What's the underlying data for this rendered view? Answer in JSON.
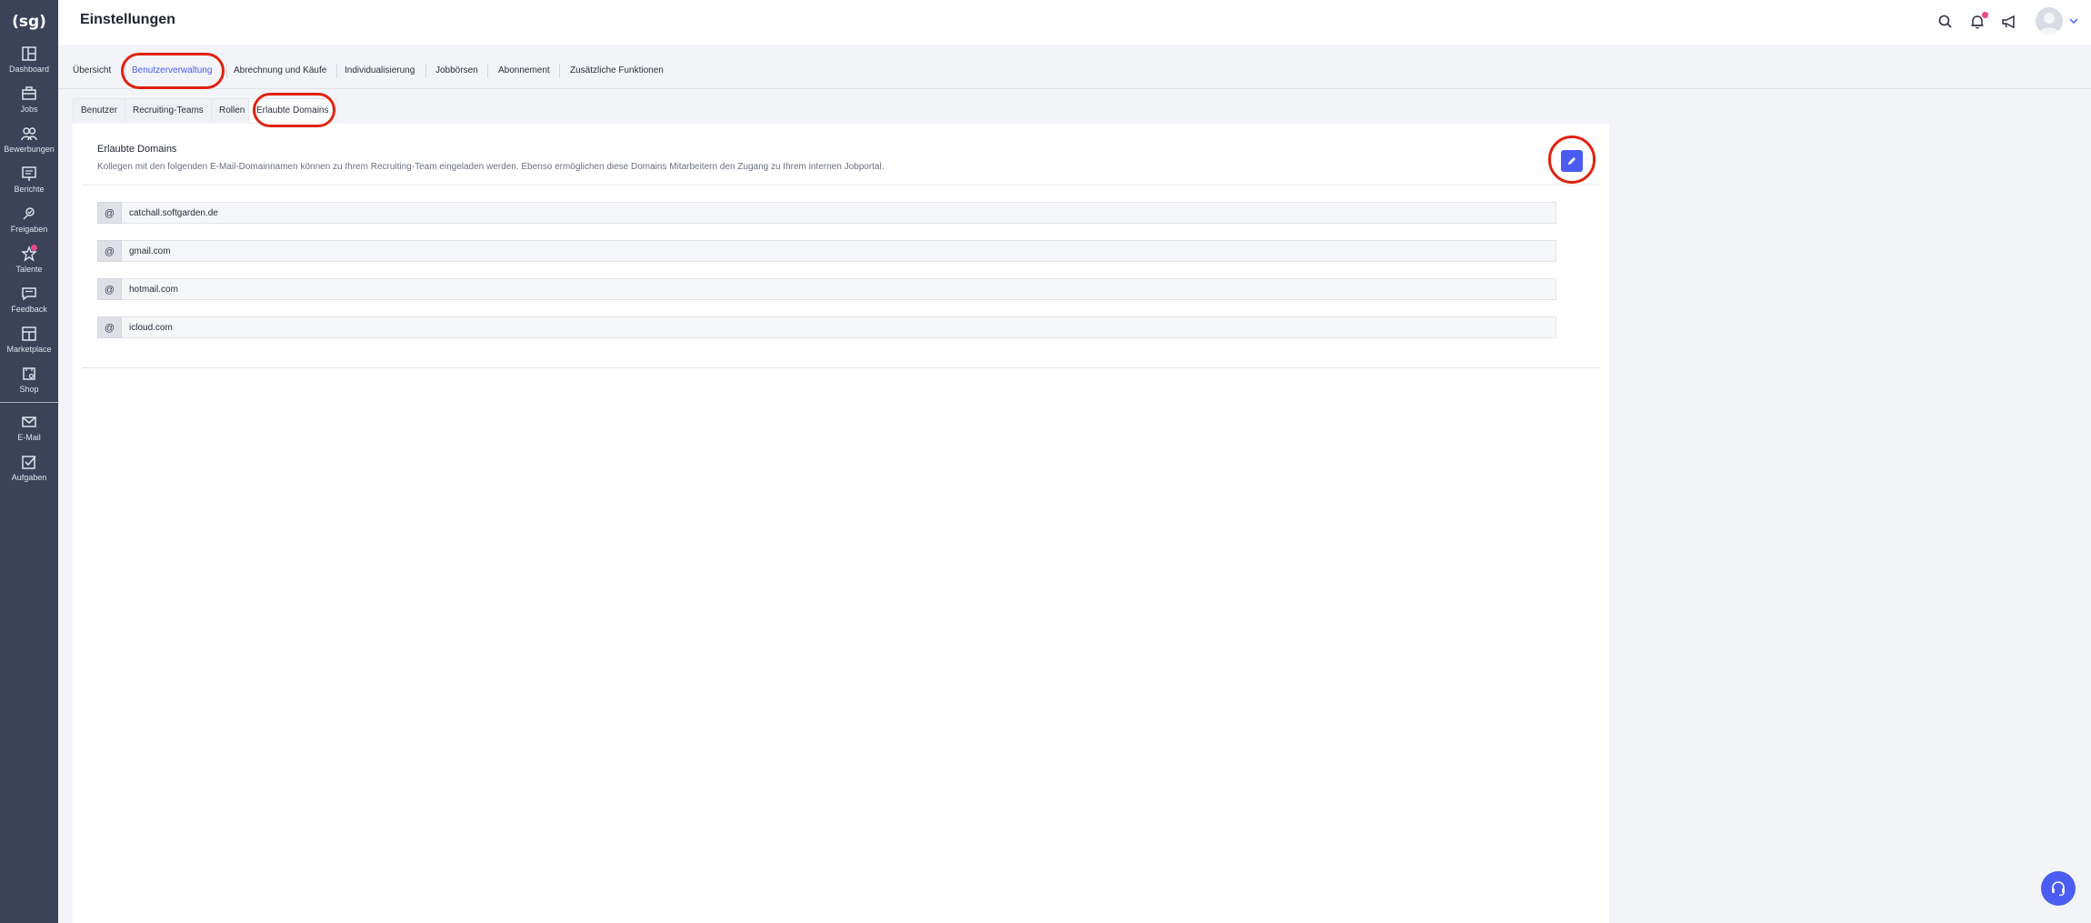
{
  "app": {
    "logo_text": "(sg)"
  },
  "header": {
    "title": "Einstellungen"
  },
  "sidebar": {
    "items": [
      {
        "label": "Dashboard"
      },
      {
        "label": "Jobs"
      },
      {
        "label": "Bewerbungen"
      },
      {
        "label": "Berichte"
      },
      {
        "label": "Freigaben"
      },
      {
        "label": "Talente"
      },
      {
        "label": "Feedback"
      },
      {
        "label": "Marketplace"
      },
      {
        "label": "Shop"
      },
      {
        "label": "E-Mail"
      },
      {
        "label": "Aufgaben"
      }
    ]
  },
  "tabs": {
    "main": [
      {
        "label": "Übersicht"
      },
      {
        "label": "Benutzerverwaltung",
        "active": true
      },
      {
        "label": "Abrechnung und Käufe"
      },
      {
        "label": "Individualisierung"
      },
      {
        "label": "Jobbörsen"
      },
      {
        "label": "Abonnement"
      },
      {
        "label": "Zusätzliche Funktionen"
      }
    ],
    "sub": [
      {
        "label": "Benutzer"
      },
      {
        "label": "Recruiting-Teams"
      },
      {
        "label": "Rollen"
      },
      {
        "label": "Erlaubte Domains",
        "active": true
      }
    ]
  },
  "card": {
    "title": "Erlaubte Domains",
    "description": "Kollegen mit den folgenden E-Mail-Domainnamen können zu Ihrem Recruiting-Team eingeladen werden. Ebenso ermöglichen diese Domains Mitarbeitern den Zugang zu Ihrem internen Jobportal.",
    "at_symbol": "@",
    "domains": [
      "catchall.softgarden.de",
      "gmail.com",
      "hotmail.com",
      "icloud.com"
    ]
  },
  "colors": {
    "accent": "#4a5cf2",
    "sidebar": "#3c4359",
    "highlight": "#e0220f",
    "notification": "#e84a8a"
  }
}
